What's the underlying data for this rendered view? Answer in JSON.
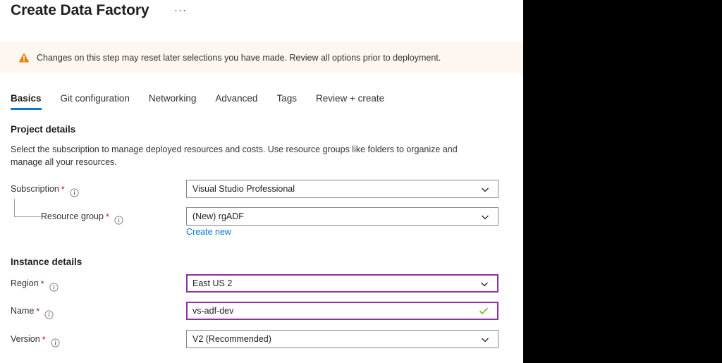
{
  "header": {
    "title": "Create Data Factory",
    "more_menu_label": "···"
  },
  "warning": {
    "icon": "warning-triangle-icon",
    "message": "Changes on this step may reset later selections you have made. Review all options prior to deployment."
  },
  "tabs": [
    {
      "label": "Basics",
      "active": true
    },
    {
      "label": "Git configuration",
      "active": false
    },
    {
      "label": "Networking",
      "active": false
    },
    {
      "label": "Advanced",
      "active": false
    },
    {
      "label": "Tags",
      "active": false
    },
    {
      "label": "Review + create",
      "active": false
    }
  ],
  "project_details": {
    "heading": "Project details",
    "description": "Select the subscription to manage deployed resources and costs. Use resource groups like folders to organize and manage all your resources.",
    "subscription": {
      "label": "Subscription",
      "required_marker": "*",
      "info_icon": "info-circle-icon",
      "value": "Visual Studio Professional",
      "chevron_icon": "chevron-down-icon"
    },
    "resource_group": {
      "label": "Resource group",
      "required_marker": "*",
      "info_icon": "info-circle-icon",
      "value": "(New) rgADF",
      "chevron_icon": "chevron-down-icon",
      "create_new_link": "Create new"
    }
  },
  "instance_details": {
    "heading": "Instance details",
    "region": {
      "label": "Region",
      "required_marker": "*",
      "info_icon": "info-circle-icon",
      "value": "East US 2",
      "chevron_icon": "chevron-down-icon"
    },
    "name": {
      "label": "Name",
      "required_marker": "*",
      "info_icon": "info-circle-icon",
      "value": "vs-adf-dev",
      "validation_icon": "checkmark-icon"
    },
    "version": {
      "label": "Version",
      "required_marker": "*",
      "info_icon": "info-circle-icon",
      "value": "V2 (Recommended)",
      "chevron_icon": "chevron-down-icon"
    }
  },
  "colors": {
    "accent_blue": "#0078d4",
    "required_red": "#a4262c",
    "warning_orange": "#e8820c",
    "warning_bg": "#fdf6f1",
    "focus_purple": "#912fa4",
    "valid_green": "#6bb700",
    "border_gray": "#8a8886"
  }
}
